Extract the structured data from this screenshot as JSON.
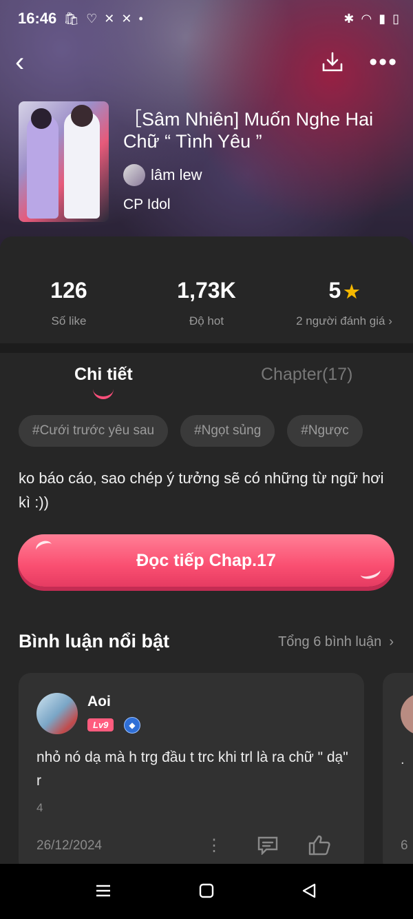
{
  "status_bar": {
    "time": "16:46"
  },
  "story": {
    "title": "［Sâm Nhiên] Muốn Nghe Hai Chữ “ Tình Yêu ”",
    "author": "lâm lew",
    "category": "CP Idol"
  },
  "stats": {
    "likes": {
      "value": "126",
      "label": "Số like"
    },
    "hot": {
      "value": "1,73K",
      "label": "Độ hot"
    },
    "rating": {
      "value": "5",
      "label": "2 người đánh giá"
    }
  },
  "tabs": {
    "detail": "Chi tiết",
    "chapters": "Chapter(17)"
  },
  "tags": [
    "#Cưới trước yêu sau",
    "#Ngọt sủng",
    "#Ngược"
  ],
  "description": "ko báo cáo, sao chép ý tưởng sẽ có những từ ngữ hơi kì :))",
  "continue_button": "Đọc tiếp Chap.17",
  "comments_section": {
    "title": "Bình luận nổi bật",
    "total": "Tổng 6 bình luận",
    "comments": [
      {
        "user": "Aoi",
        "level": "Lv9",
        "text": "nhỏ nó dạ mà h trg đầu t trc khi trl là ra chữ \" dạ\" r",
        "count": "4",
        "date": "26/12/2024"
      },
      {
        "text": ".",
        "count": "6"
      }
    ]
  },
  "colors": {
    "accent": "#fa4f71",
    "star": "#f5b800",
    "background": "#262626"
  }
}
